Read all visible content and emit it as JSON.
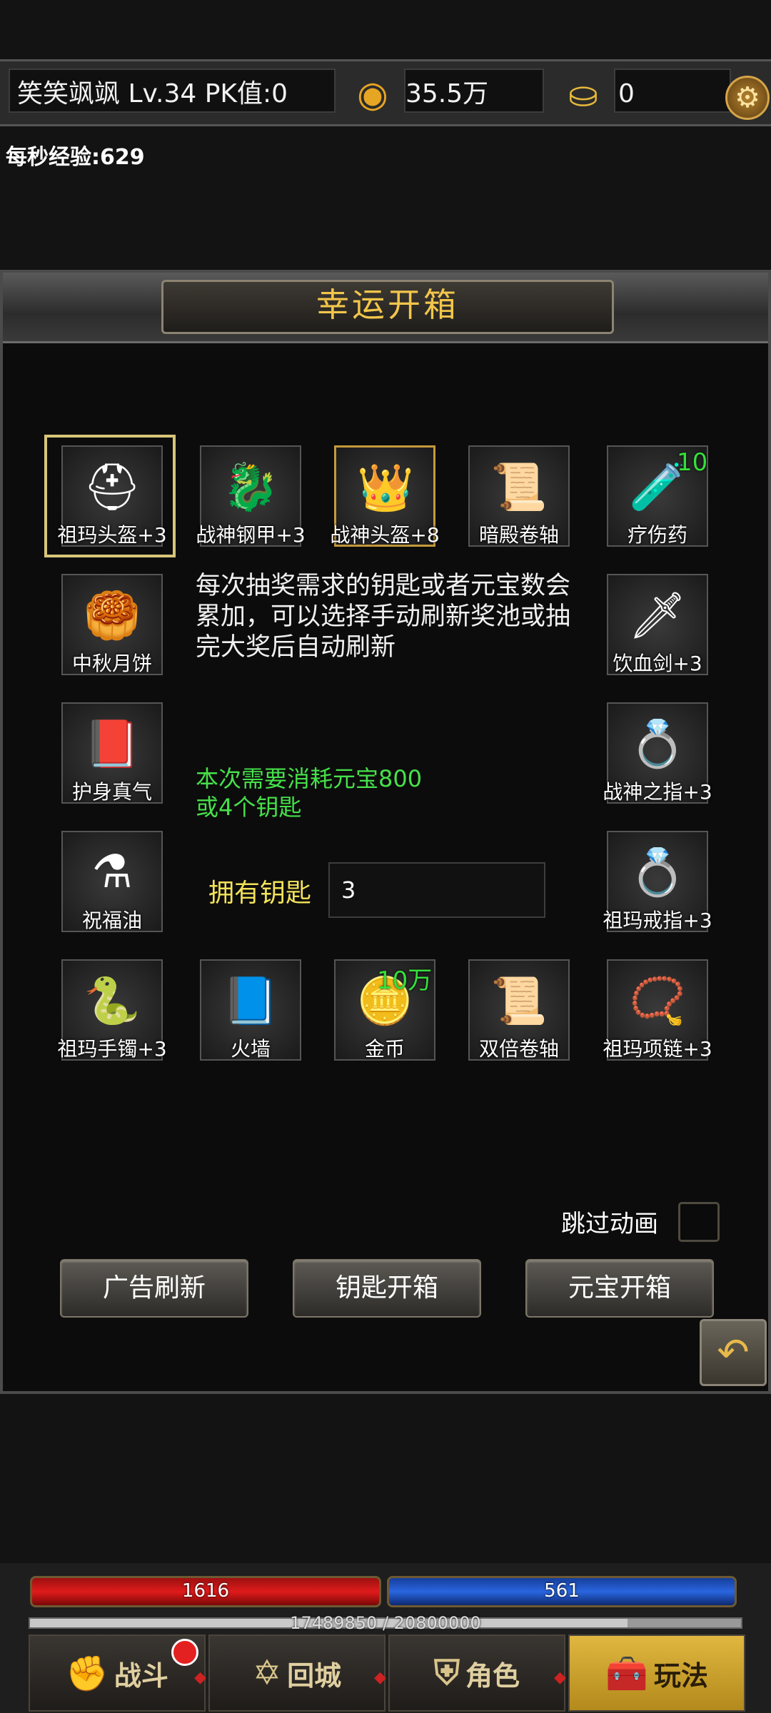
{
  "topbar": {
    "player": "笑笑飒飒  Lv.34 PK值:0",
    "coins": "35.5万",
    "ingots": "0",
    "coin_icon": "coin-icon",
    "ingot_icon": "ingot-icon",
    "settings_icon": "gear-icon"
  },
  "exp_rate": "每秒经验:629",
  "panel": {
    "title": "幸运开箱",
    "info": "每次抽奖需求的钥匙或者元宝数会累加，可以选择手动刷新奖池或抽完大奖后自动刷新",
    "cost_line1": "本次需要消耗元宝800",
    "cost_line2": "或4个钥匙",
    "keys_label": "拥有钥匙",
    "keys_value": "3",
    "skip_label": "跳过动画",
    "buttons": {
      "ad_refresh": "广告刷新",
      "key_open": "钥匙开箱",
      "ingot_open": "元宝开箱"
    }
  },
  "items": [
    {
      "label": "祖玛头盔+3",
      "icon": "⛑"
    },
    {
      "label": "战神钢甲+3",
      "icon": "🐉"
    },
    {
      "label": "战神头盔+8",
      "icon": "👑"
    },
    {
      "label": "暗殿卷轴",
      "icon": "📜"
    },
    {
      "label": "疗伤药",
      "icon": "🧪",
      "count": "10"
    },
    {
      "label": "中秋月饼",
      "icon": "🥮"
    },
    {
      "label": "饮血剑+3",
      "icon": "🗡"
    },
    {
      "label": "护身真气",
      "icon": "📕"
    },
    {
      "label": "战神之指+3",
      "icon": "💍"
    },
    {
      "label": "祝福油",
      "icon": "⚗"
    },
    {
      "label": "祖玛戒指+3",
      "icon": "💍"
    },
    {
      "label": "祖玛手镯+3",
      "icon": "🐍"
    },
    {
      "label": "火墙",
      "icon": "📘"
    },
    {
      "label": "金币",
      "icon": "🪙",
      "count": "10万"
    },
    {
      "label": "双倍卷轴",
      "icon": "📜"
    },
    {
      "label": "祖玛项链+3",
      "icon": "📿"
    }
  ],
  "status": {
    "hp": "1616",
    "mp": "561",
    "exp": "17489850 / 20800000",
    "exp_fraction": 0.8408
  },
  "tabs": [
    {
      "label": "战斗",
      "icon": "✊"
    },
    {
      "label": "回城",
      "icon": "✡"
    },
    {
      "label": "角色",
      "icon": "⛨"
    },
    {
      "label": "玩法",
      "icon": "🧰"
    }
  ],
  "colors": {
    "title_gold": "#f2c64a",
    "cost_green": "#46e04a",
    "keys_yellow": "#f2e25a",
    "hp_red": "#e01b1b",
    "mp_blue": "#2a66e0"
  }
}
